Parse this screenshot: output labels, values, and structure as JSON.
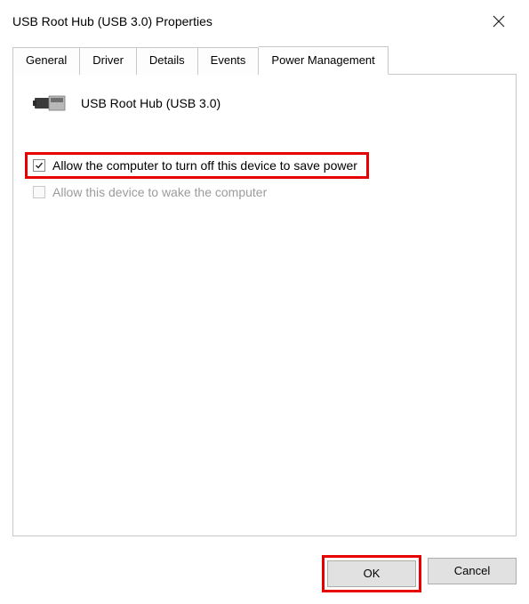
{
  "window": {
    "title": "USB Root Hub (USB 3.0) Properties"
  },
  "tabs": {
    "general": "General",
    "driver": "Driver",
    "details": "Details",
    "events": "Events",
    "power": "Power Management"
  },
  "device": {
    "name": "USB Root Hub (USB 3.0)"
  },
  "options": {
    "allow_turn_off": "Allow the computer to turn off this device to save power",
    "allow_wake": "Allow this device to wake the computer"
  },
  "buttons": {
    "ok": "OK",
    "cancel": "Cancel"
  }
}
